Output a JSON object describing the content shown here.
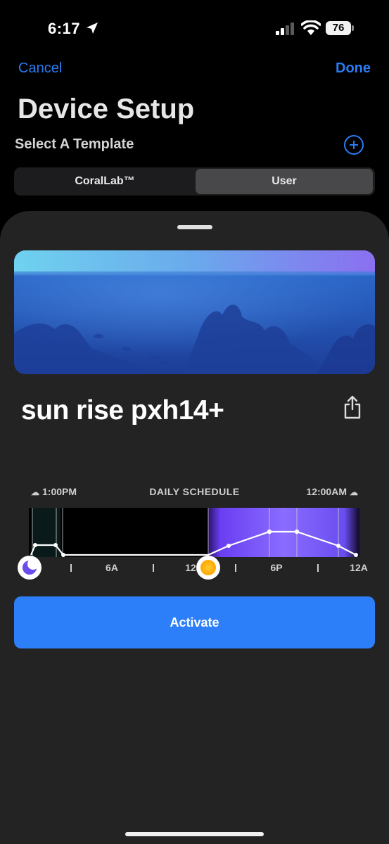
{
  "status_bar": {
    "time": "6:17",
    "battery": "76"
  },
  "nav": {
    "cancel": "Cancel",
    "done": "Done"
  },
  "title": "Device Setup",
  "subtitle": "Select A Template",
  "segment": {
    "left": "CoralLab™",
    "right": "User",
    "selected": "User"
  },
  "template": {
    "name": "sun rise pxh14+"
  },
  "schedule": {
    "start_time": "1:00PM",
    "heading": "DAILY SCHEDULE",
    "end_time": "12:00AM",
    "tick_labels": [
      "6A",
      "12",
      "6P",
      "12A"
    ]
  },
  "activate_label": "Activate",
  "colors": {
    "accent": "#2a7cf3",
    "button": "#2d7ff9",
    "sheet": "#232323"
  }
}
